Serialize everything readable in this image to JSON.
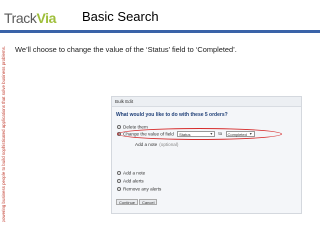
{
  "side_tagline": "Empowering business people to build sophisticated applications that solve business problems.",
  "logo": {
    "part1": "Track",
    "part2": "Via"
  },
  "slide": {
    "title": "Basic Search",
    "body": "We’ll choose to change the value of the ‘Status’ field to ‘Completed’."
  },
  "bulk_edit": {
    "header": "Bulk Edit",
    "question": "What would you like to do with these 5 orders?",
    "options": {
      "delete": "Delete them",
      "change_value": "Change the value of field",
      "add_note_option": "Add a note",
      "add_alerts": "Add alerts",
      "remove_alerts": "Remove any alerts"
    },
    "field_select_value": "Status",
    "to_word": "to",
    "value_select_value": "Completed",
    "add_note_link": "Add a note",
    "optional_hint": "(optional)",
    "continue_label": "Continue",
    "cancel_label": "Cancel"
  },
  "colors": {
    "title_bar": "#3a63a8",
    "logo_accent": "#9fbf3b",
    "highlight": "#d62b2b",
    "tagline": "#c0392b"
  }
}
